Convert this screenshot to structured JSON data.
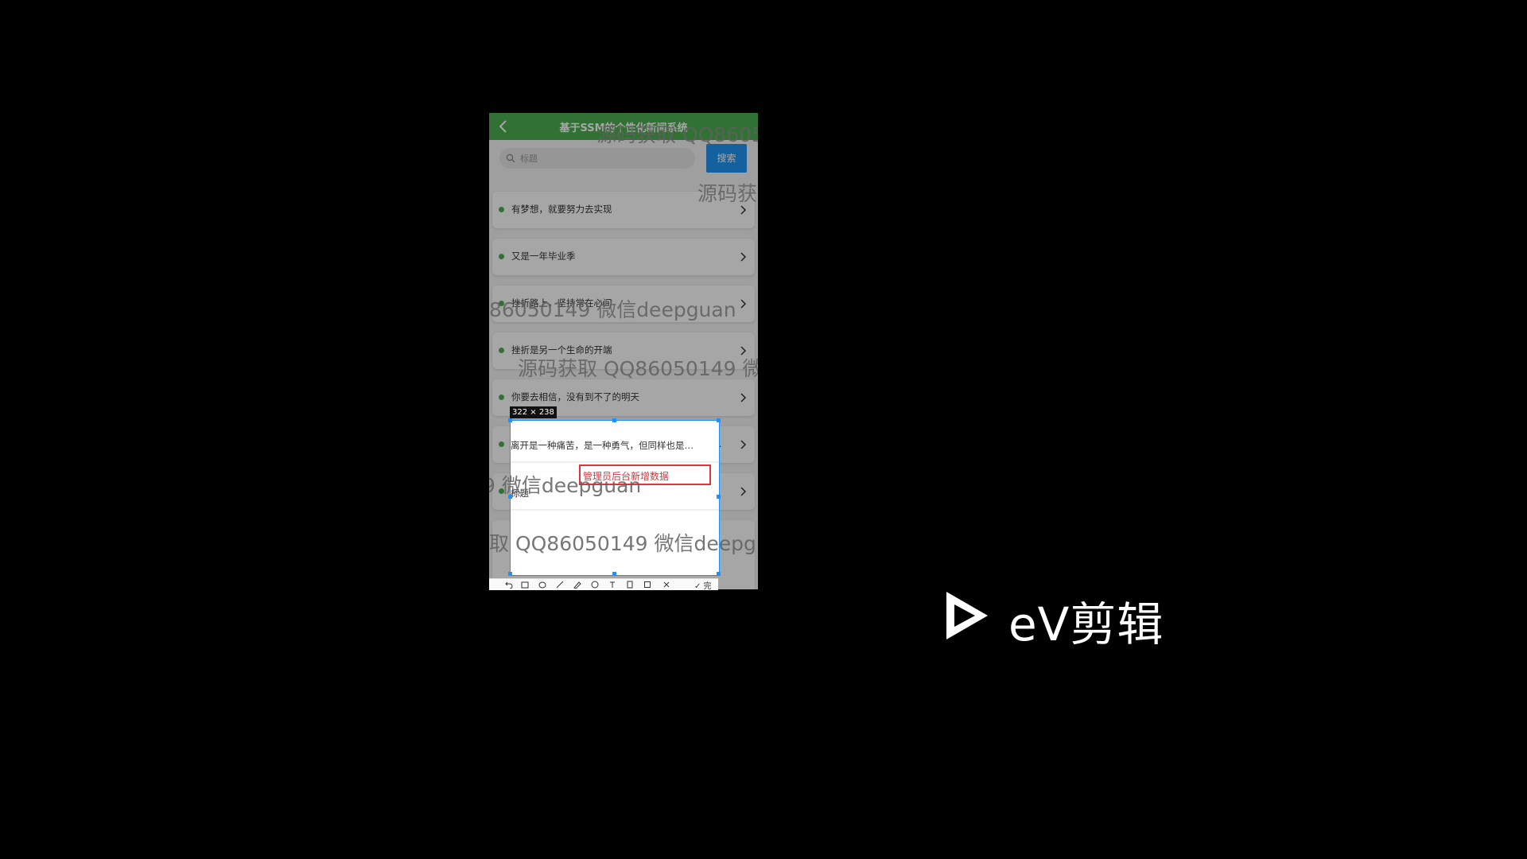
{
  "app": {
    "title": "基于SSM的个性化新闻系统",
    "search_placeholder": "标题",
    "search_button": "搜索"
  },
  "list_items": [
    "有梦想，就要努力去实现",
    "又是一年毕业季",
    "挫折路上，坚持常在心间",
    "挫折是另一个生命的开端",
    "你要去相信，没有到不了的明天",
    "离开是一种痛苦，是一种勇气，但同样也是一个新的开始",
    "标题"
  ],
  "screenshot_tool": {
    "size_label": "322 × 238",
    "annotation": "管理员后台新增数据",
    "done_label": "✓ 完成"
  },
  "watermarks": [
    "源码获取 QQ86050149 微信deepguan",
    "源码获取",
    "86050149 微信deepguan",
    "源码获取 QQ86050149 微信deepguan",
    "9 微信deepguan",
    "取 QQ86050149 微信deepguan"
  ],
  "branding": {
    "logo_text": "eV剪辑"
  },
  "colors": {
    "appbar": "#4caf50",
    "search_button": "#2196f3",
    "annotation": "#d9363e",
    "selection": "#1e90ff"
  }
}
